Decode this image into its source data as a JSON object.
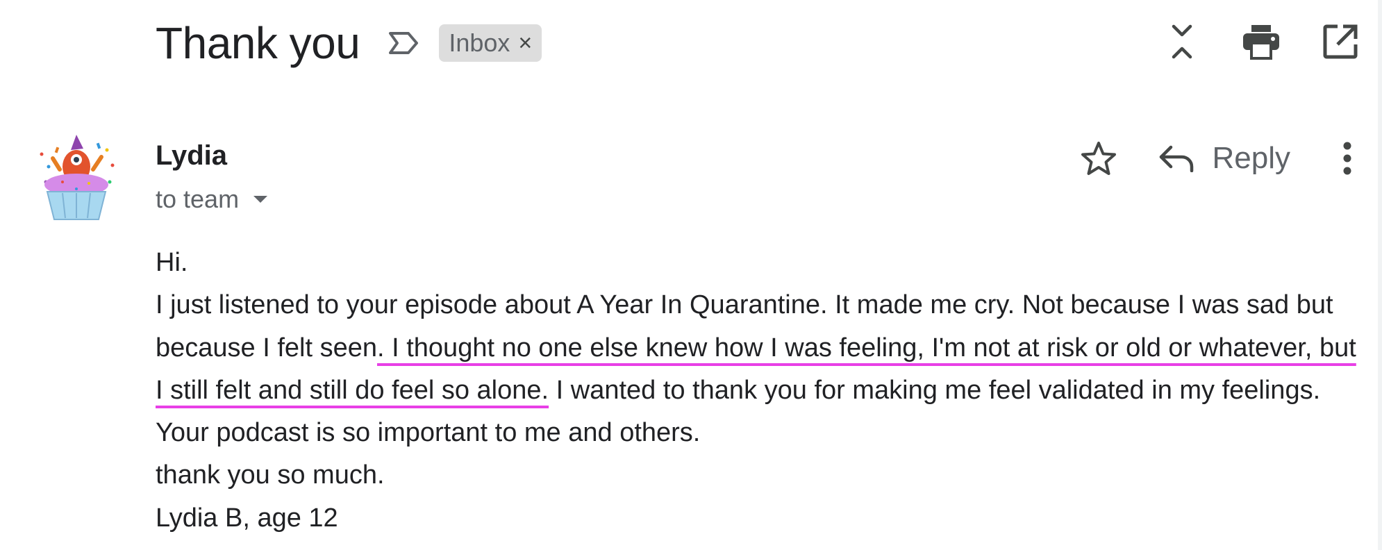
{
  "subject": {
    "title": "Thank you",
    "label": "Inbox",
    "label_remove_symbol": "×"
  },
  "icons": {
    "important": "important-marker-icon",
    "collapse": "expand-collapse-icon",
    "print": "print-icon",
    "new_window": "open-in-new-window-icon",
    "star": "star-icon",
    "reply": "reply-arrow-icon",
    "more": "more-vert-icon",
    "caret": "caret-down-icon",
    "avatar": "party-cupcake-avatar"
  },
  "message": {
    "sender": "Lydia",
    "recipients": "to team",
    "reply_label": "Reply",
    "body": {
      "greeting": "Hi.",
      "p2_before": "I just listened to your episode about A Year In Quarantine. It made me cry. Not because I was sad but because I felt seen",
      "p2_highlight": ". I thought no one else knew how I was feeling, I'm not at risk or old or whatever, but I still felt and still do feel so alone.",
      "p2_after": " I wanted to thank you for making me feel validated in my feelings. Your podcast is so important to me and others.",
      "closing": "thank you so much.",
      "signature": "Lydia B, age 12"
    }
  },
  "colors": {
    "highlight_underline": "#e83fe6",
    "label_chip_bg": "#dddddd",
    "text_primary": "#202124",
    "text_secondary": "#5f6368"
  }
}
